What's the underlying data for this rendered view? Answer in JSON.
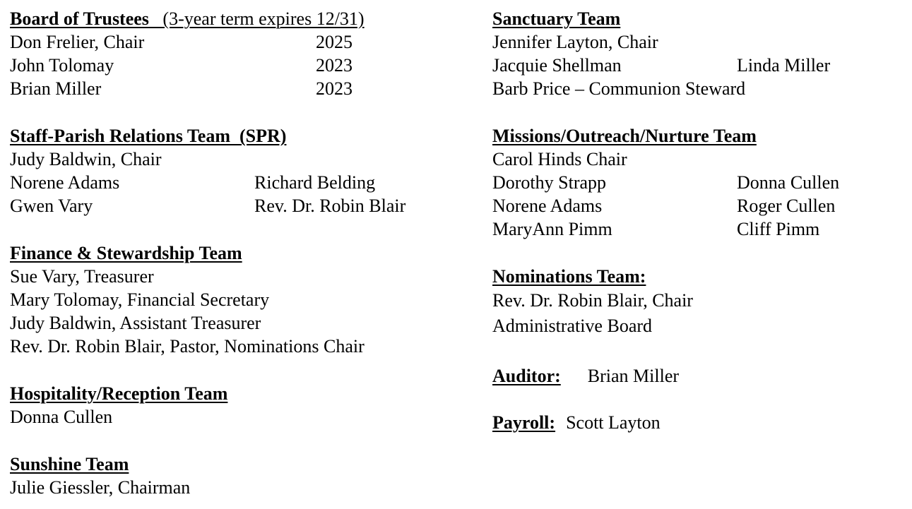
{
  "left": {
    "trustees": {
      "heading": "Board of Trustees",
      "note": "(3-year term expires 12/31)",
      "members": [
        {
          "name": "Don Frelier, Chair",
          "year": "2025"
        },
        {
          "name": "John Tolomay",
          "year": "2023"
        },
        {
          "name": "Brian Miller",
          "year": "2023"
        }
      ]
    },
    "spr": {
      "heading": "Staff-Parish Relations Team  (SPR)",
      "chair": "Judy Baldwin, Chair",
      "rows": [
        [
          "Norene Adams",
          "Richard Belding"
        ],
        [
          "Gwen Vary",
          "Rev. Dr. Robin Blair"
        ]
      ]
    },
    "finance": {
      "heading": "Finance & Stewardship Team",
      "members": [
        "Sue Vary, Treasurer",
        "Mary Tolomay, Financial Secretary",
        "Judy Baldwin, Assistant Treasurer",
        "Rev. Dr. Robin Blair, Pastor, Nominations Chair"
      ]
    },
    "hospitality": {
      "heading": "Hospitality/Reception Team",
      "members": [
        "Donna Cullen"
      ]
    },
    "sunshine": {
      "heading": "Sunshine Team",
      "members": [
        "Julie Giessler, Chairman"
      ]
    }
  },
  "right": {
    "sanctuary": {
      "heading": "Sanctuary Team",
      "chair": "Jennifer Layton, Chair",
      "row": [
        "Jacquie Shellman",
        "Linda Miller"
      ],
      "steward": "Barb Price – Communion Steward"
    },
    "missions": {
      "heading": "Missions/Outreach/Nurture Team",
      "chair": "Carol Hinds Chair",
      "rows": [
        [
          "Dorothy Strapp",
          "Donna Cullen"
        ],
        [
          "Norene Adams",
          "Roger Cullen"
        ],
        [
          "MaryAnn Pimm",
          "Cliff Pimm"
        ]
      ]
    },
    "nominations": {
      "heading": "Nominations Team:",
      "members": [
        "Rev. Dr. Robin Blair, Chair",
        "Administrative Board"
      ]
    },
    "auditor": {
      "label": "Auditor:",
      "name": "Brian Miller"
    },
    "payroll": {
      "label": "Payroll:",
      "name": "Scott Layton"
    }
  }
}
